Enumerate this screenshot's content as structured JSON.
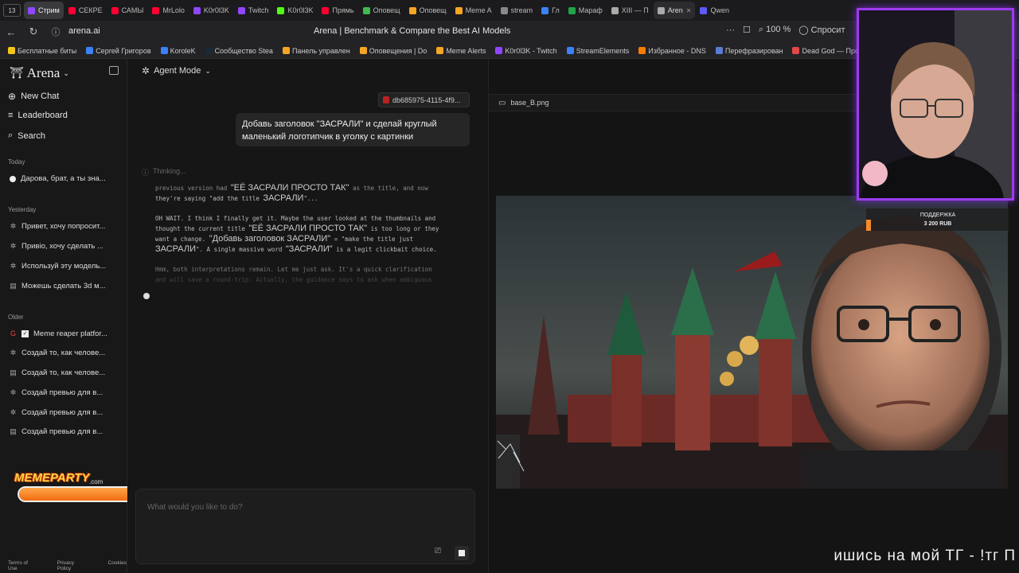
{
  "browser": {
    "tab_count": "13",
    "tabs": [
      {
        "label": "Стрим",
        "color": "#9146ff",
        "state": "active"
      },
      {
        "label": "СЕКРЕ",
        "color": "#ff0033"
      },
      {
        "label": "САМЫ",
        "color": "#ff0033"
      },
      {
        "label": "MrLolo",
        "color": "#ff0033"
      },
      {
        "label": "K0r0l3K",
        "color": "#9146ff"
      },
      {
        "label": "Twitch",
        "color": "#9146ff"
      },
      {
        "label": "K0r0l3K",
        "color": "#53fc18"
      },
      {
        "label": "Прямь",
        "color": "#ff0033"
      },
      {
        "label": "Оповещ",
        "color": "#3fb950"
      },
      {
        "label": "Оповещ",
        "color": "#f5a623"
      },
      {
        "label": "Meme A",
        "color": "#f5a623"
      },
      {
        "label": "stream",
        "color": "#888888"
      },
      {
        "label": "Гл",
        "color": "#3b82f6"
      },
      {
        "label": "Мараф",
        "color": "#22a34a"
      },
      {
        "label": "XIII — П",
        "color": "#aaaaaa"
      },
      {
        "label": "Aren",
        "color": "#aaaaaa",
        "state": "current"
      },
      {
        "label": "Qwen",
        "color": "#5b5bf5"
      }
    ],
    "url": "arena.ai",
    "page_title": "Arena | Benchmark & Compare the Best AI Models",
    "zoom": "100 %",
    "ask_label": "Спросит",
    "bookmarks": [
      {
        "label": "Бесплатные биты",
        "color": "#f5c518"
      },
      {
        "label": "Сергей Григоров",
        "color": "#3b82f6"
      },
      {
        "label": "KoroleK",
        "color": "#3b82f6"
      },
      {
        "label": "Сообщество Stea",
        "color": "#1b2838"
      },
      {
        "label": "Панель управлен",
        "color": "#f5a623"
      },
      {
        "label": "Оповещения | Do",
        "color": "#f5a623"
      },
      {
        "label": "Meme Alerts",
        "color": "#f5a623"
      },
      {
        "label": "K0r0l3K - Twitch",
        "color": "#9146ff"
      },
      {
        "label": "StreamElements",
        "color": "#3b82f6"
      },
      {
        "label": "Избранное - DNS",
        "color": "#f57c00"
      },
      {
        "label": "Перефразирован",
        "color": "#5b7bd5"
      },
      {
        "label": "Dead God — Прос",
        "color": "#e04848"
      }
    ]
  },
  "sidebar": {
    "logo": "Arena",
    "nav": [
      {
        "label": "New Chat",
        "icon": "plus-circle-icon"
      },
      {
        "label": "Leaderboard",
        "icon": "list-icon"
      },
      {
        "label": "Search",
        "icon": "search-icon"
      }
    ],
    "today_label": "Today",
    "today": [
      {
        "label": "Дарова, брат, а ты зна..."
      }
    ],
    "yesterday_label": "Yesterday",
    "yesterday": [
      {
        "label": "Привет, хочу попросит..."
      },
      {
        "label": "Привіо, хочу сделать ..."
      },
      {
        "label": "Используй эту модель..."
      },
      {
        "label": "Можешь сделать 3d м..."
      }
    ],
    "older_label": "Older",
    "older": [
      {
        "label": "Meme reaper platfor..."
      },
      {
        "label": "Создай то, как челове..."
      },
      {
        "label": "Создай то, как челове..."
      },
      {
        "label": "Создай превью для в..."
      },
      {
        "label": "Создай превью для в..."
      },
      {
        "label": "Создай превью для в..."
      }
    ],
    "footer": [
      "Terms of Use",
      "Privacy Policy",
      "Cookies"
    ]
  },
  "overlay": {
    "meme_brand": "MEMEPARTY",
    "meme_domain": ".com",
    "meme_progress": 0.72,
    "donation_title": "ПОДДЕРЖКА",
    "donation_amount": "3 200 RUB",
    "ticker": "ишись на мой ТГ - !тг П"
  },
  "chat": {
    "mode": "Agent Mode",
    "attachment": "db685975-4115-4f9...",
    "user_message": "Добавь заголовок \"ЗАСРАЛИ\" и сделай круглый маленький логотипчик в уголку с картинки",
    "thinking_label": "Thinking...",
    "thought_1a": "previous version had ",
    "thought_1b": "\"ЕЁ ЗАСРАЛИ ПРОСТО ТАК\"",
    "thought_1c": " as the title, and now",
    "thought_2a": "they're saying \"add the title ",
    "thought_2b": "ЗАСРАЛИ",
    "thought_2c": "\"...",
    "thought_3": "OH WAIT. I think I finally get it. Maybe the user looked at the thumbnails and",
    "thought_4a": "thought the current title ",
    "thought_4b": "\"ЕЁ ЗАСРАЛИ ПРОСТО ТАК\"",
    "thought_4c": " is too long or they",
    "thought_5a": "want a change. ",
    "thought_5b": "\"Добавь заголовок ЗАСРАЛИ\"",
    "thought_5c": " = \"make the title just",
    "thought_6a": "ЗАСРАЛИ",
    "thought_6b": "\". A single massive word ",
    "thought_6c": "\"ЗАСРАЛИ\"",
    "thought_6d": " is a legit clickbait choice.",
    "thought_7": "Hmm, both interpretations remain. Let me just ask. It's a quick clarification",
    "thought_8": "and will save a round-trip. Actually, the guidance says to ask when ambiguous",
    "input_placeholder": "What would you like to do?"
  },
  "preview": {
    "filename": "base_B.png"
  }
}
